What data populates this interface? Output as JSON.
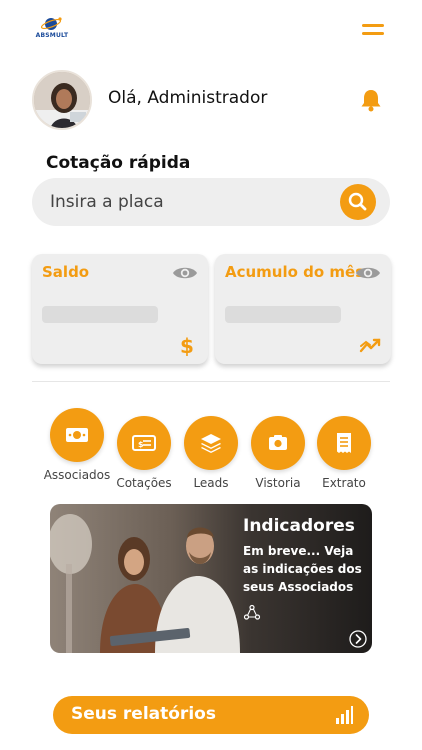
{
  "brand": {
    "logo_text": "ABSMULT",
    "logo_color": "#1a4a9a"
  },
  "theme": {
    "accent": "#f39c12",
    "card_bg": "#eeeeee"
  },
  "header": {
    "menu_icon": "hamburger-menu-icon",
    "greeting": "Olá, Administrador",
    "notification_icon": "bell-icon"
  },
  "quick_quote": {
    "title": "Cotação rápida",
    "placeholder": "Insira a placa",
    "search_icon": "search-icon"
  },
  "cards": [
    {
      "label": "Saldo",
      "eye_icon": "eye-icon",
      "icon": "dollar-icon"
    },
    {
      "label": "Acumulo do mês",
      "eye_icon": "eye-icon",
      "icon": "trend-icon"
    }
  ],
  "actions": [
    {
      "label": "Associados",
      "icon": "money-icon"
    },
    {
      "label": "Cotações",
      "icon": "check-icon"
    },
    {
      "label": "Leads",
      "icon": "layers-icon"
    },
    {
      "label": "Vistoria",
      "icon": "camera-icon"
    },
    {
      "label": "Extrato",
      "icon": "receipt-icon"
    }
  ],
  "banner": {
    "title": "Indicadores",
    "text": "Em breve... Veja as indicações dos seus Associados",
    "share_icon": "share-icon",
    "next_icon": "chevron-right-icon"
  },
  "reports": {
    "label": "Seus relatórios",
    "icon": "bar-chart-icon"
  }
}
